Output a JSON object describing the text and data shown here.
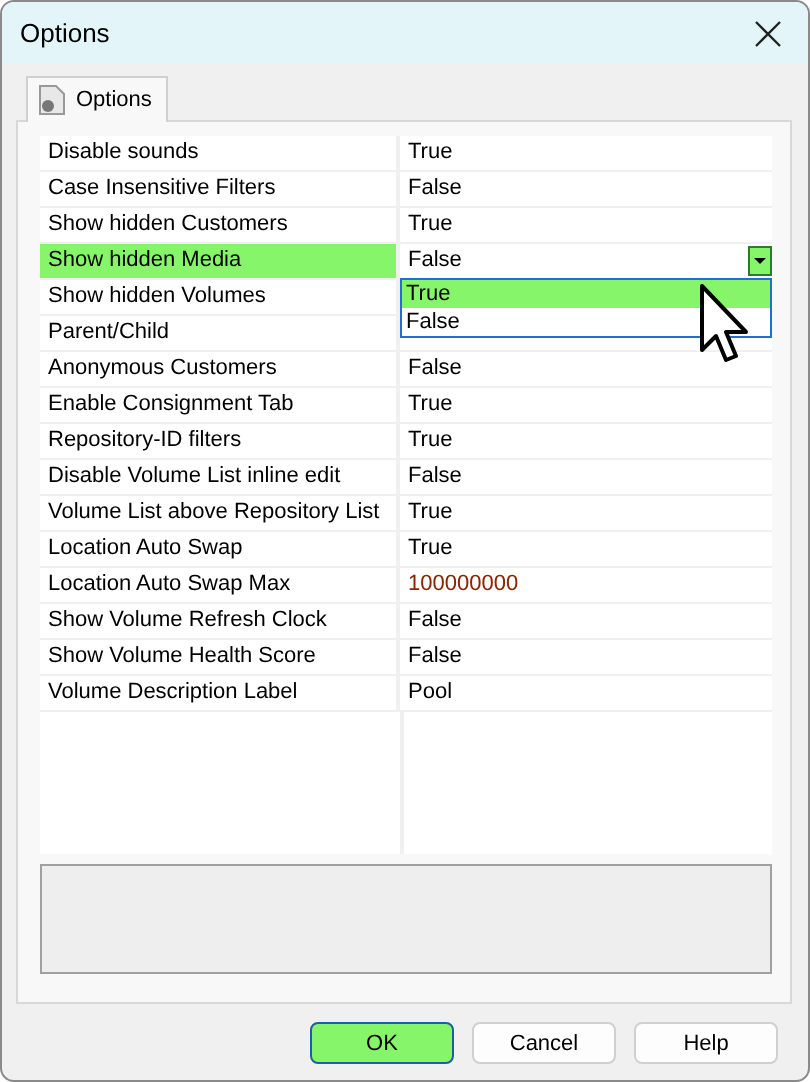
{
  "window": {
    "title": "Options"
  },
  "tabs": [
    {
      "label": "Options",
      "selected": true
    }
  ],
  "properties": [
    {
      "name": "Disable sounds",
      "value": "True",
      "selected": false,
      "color": "#000000"
    },
    {
      "name": "Case Insensitive Filters",
      "value": "False",
      "selected": false,
      "color": "#000000"
    },
    {
      "name": "Show hidden Customers",
      "value": "True",
      "selected": false,
      "color": "#000000"
    },
    {
      "name": "Show hidden Media",
      "value": "False",
      "selected": true,
      "color": "#000000",
      "dropdown": {
        "options": [
          {
            "label": "True",
            "selected": true
          },
          {
            "label": "False",
            "selected": false
          }
        ]
      }
    },
    {
      "name": "Show hidden Volumes",
      "selected": false
    },
    {
      "name": "Parent/Child",
      "selected": false
    },
    {
      "name": "Anonymous Customers",
      "value": "False",
      "selected": false,
      "color": "#000000"
    },
    {
      "name": "Enable Consignment Tab",
      "value": "True",
      "selected": false,
      "color": "#000000"
    },
    {
      "name": "Repository-ID filters",
      "value": "True",
      "selected": false,
      "color": "#000000"
    },
    {
      "name": "Disable Volume List inline edit",
      "value": "False",
      "selected": false,
      "color": "#000000"
    },
    {
      "name": "Volume List above Repository List",
      "value": "True",
      "selected": false,
      "color": "#000000"
    },
    {
      "name": "Location Auto Swap",
      "value": "True",
      "selected": false,
      "color": "#000000"
    },
    {
      "name": "Location Auto Swap Max",
      "value": "100000000",
      "selected": false,
      "color": "#8b2500"
    },
    {
      "name": "Show Volume Refresh Clock",
      "value": "False",
      "selected": false,
      "color": "#000000"
    },
    {
      "name": "Show Volume Health Score",
      "value": "False",
      "selected": false,
      "color": "#000000"
    },
    {
      "name": "Volume Description Label",
      "value": "Pool",
      "selected": false,
      "color": "#000000"
    }
  ],
  "buttons": [
    {
      "label": "OK",
      "selected": true
    },
    {
      "label": "Cancel",
      "selected": false
    },
    {
      "label": "Help",
      "selected": false
    }
  ]
}
